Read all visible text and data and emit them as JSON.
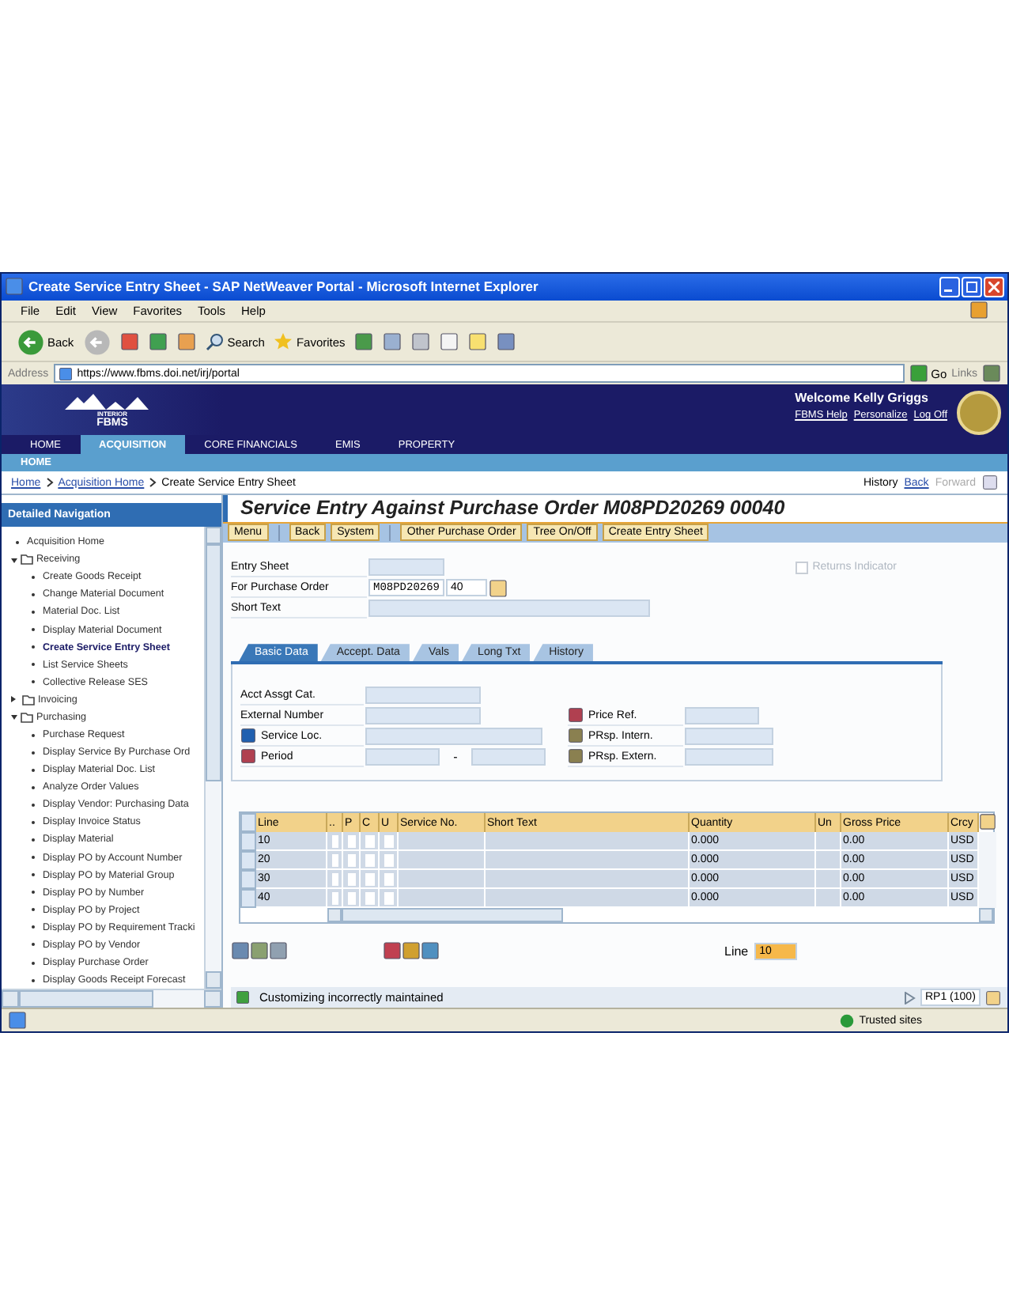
{
  "window": {
    "title": "Create Service Entry Sheet - SAP NetWeaver Portal - Microsoft Internet Explorer"
  },
  "menu": [
    "File",
    "Edit",
    "View",
    "Favorites",
    "Tools",
    "Help"
  ],
  "toolbar": {
    "back": "Back",
    "search": "Search",
    "favorites": "Favorites"
  },
  "address": {
    "label": "Address",
    "url": "https://www.fbms.doi.net/irj/portal",
    "go": "Go",
    "links": "Links"
  },
  "portal": {
    "logo_top": "INTERIOR",
    "logo_name": "FBMS",
    "welcome": "Welcome Kelly Griggs",
    "links": [
      "FBMS Help",
      "Personalize",
      "Log Off"
    ],
    "tabs": [
      {
        "label": "HOME",
        "selected": false
      },
      {
        "label": "ACQUISITION",
        "selected": true
      },
      {
        "label": "CORE FINANCIALS",
        "selected": false
      },
      {
        "label": "EMIS",
        "selected": false
      },
      {
        "label": "PROPERTY",
        "selected": false
      }
    ],
    "subnav": "HOME"
  },
  "breadcrumb": {
    "links": [
      "Home",
      "Acquisition Home"
    ],
    "current": "Create Service Entry Sheet",
    "history": "History",
    "back": "Back",
    "forward": {
      "label": "Forward",
      "disabled": true
    }
  },
  "nav": {
    "title": "Detailed Navigation",
    "tree": [
      {
        "kind": "link",
        "label": "Acquisition Home",
        "selected": false
      },
      {
        "kind": "folder",
        "label": "Receiving",
        "expanded": true,
        "children": [
          {
            "kind": "link",
            "label": "Create Goods Receipt",
            "selected": false
          },
          {
            "kind": "link",
            "label": "Change Material Document",
            "selected": false
          },
          {
            "kind": "link",
            "label": "Material Doc. List",
            "selected": false
          },
          {
            "kind": "link",
            "label": "Display Material Document",
            "selected": false
          },
          {
            "kind": "link",
            "label": "Create Service Entry Sheet",
            "selected": true
          },
          {
            "kind": "link",
            "label": "List Service Sheets",
            "selected": false
          },
          {
            "kind": "link",
            "label": "Collective Release SES",
            "selected": false
          }
        ]
      },
      {
        "kind": "folder",
        "label": "Invoicing",
        "expanded": false
      },
      {
        "kind": "folder",
        "label": "Purchasing",
        "expanded": true,
        "children": [
          {
            "kind": "link",
            "label": "Purchase Request",
            "selected": false
          },
          {
            "kind": "link",
            "label": "Display Service By Purchase Ord",
            "selected": false
          },
          {
            "kind": "link",
            "label": "Display Material Doc. List",
            "selected": false
          },
          {
            "kind": "link",
            "label": "Analyze Order Values",
            "selected": false
          },
          {
            "kind": "link",
            "label": "Display Vendor: Purchasing Data",
            "selected": false
          },
          {
            "kind": "link",
            "label": "Display Invoice Status",
            "selected": false
          },
          {
            "kind": "link",
            "label": "Display Material",
            "selected": false
          },
          {
            "kind": "link",
            "label": "Display PO by Account Number",
            "selected": false
          },
          {
            "kind": "link",
            "label": "Display PO by Material Group",
            "selected": false
          },
          {
            "kind": "link",
            "label": "Display PO by Number",
            "selected": false
          },
          {
            "kind": "link",
            "label": "Display PO by Project",
            "selected": false
          },
          {
            "kind": "link",
            "label": "Display PO by Requirement Tracki",
            "selected": false
          },
          {
            "kind": "link",
            "label": "Display PO by Vendor",
            "selected": false
          },
          {
            "kind": "link",
            "label": "Display Purchase Order",
            "selected": false
          },
          {
            "kind": "link",
            "label": "Display Goods Receipt Forecast",
            "selected": false
          }
        ]
      }
    ]
  },
  "sap": {
    "title": "Service Entry Against Purchase Order M08PD20269 00040",
    "buttons": [
      "Menu",
      "Back",
      "System",
      "Other Purchase Order",
      "Tree On/Off",
      "Create Entry Sheet"
    ],
    "header": {
      "entry_sheet": "Entry Sheet",
      "po_label": "For Purchase Order",
      "po_number": "M08PD20269",
      "po_item": "40",
      "short_text": "Short Text",
      "returns": {
        "label": "Returns Indicator",
        "checked": false,
        "disabled": true
      }
    },
    "tabs": [
      {
        "label": "Basic Data",
        "selected": true
      },
      {
        "label": "Accept. Data",
        "selected": false
      },
      {
        "label": "Vals",
        "selected": false
      },
      {
        "label": "Long Txt",
        "selected": false
      },
      {
        "label": "History",
        "selected": false
      }
    ],
    "basic": {
      "acct": "Acct Assgt Cat.",
      "external": "External Number",
      "service_loc": "Service Loc.",
      "period": "Period",
      "period_sep": "-",
      "price_ref": "Price Ref.",
      "prsp_intern": "PRsp. Intern.",
      "prsp_extern": "PRsp. Extern."
    },
    "table": {
      "columns": [
        "Line",
        "..",
        "P",
        "C",
        "U",
        "Service No.",
        "Short Text",
        "Quantity",
        "Un",
        "Gross Price",
        "Crcy"
      ],
      "rows": [
        {
          "line": "10",
          "flags": [
            false,
            false,
            false,
            false
          ],
          "quantity": "0.000",
          "price": "0.00",
          "currency": "USD"
        },
        {
          "line": "20",
          "flags": [
            false,
            false,
            false,
            false
          ],
          "quantity": "0.000",
          "price": "0.00",
          "currency": "USD"
        },
        {
          "line": "30",
          "flags": [
            false,
            false,
            false,
            false
          ],
          "quantity": "0.000",
          "price": "0.00",
          "currency": "USD"
        },
        {
          "line": "40",
          "flags": [
            false,
            false,
            false,
            false
          ],
          "quantity": "0.000",
          "price": "0.00",
          "currency": "USD"
        }
      ]
    },
    "line_label": "Line",
    "line_value": "10",
    "message": "Customizing incorrectly maintained",
    "system": "RP1 (100)"
  },
  "status": {
    "zone": "Trusted sites"
  }
}
